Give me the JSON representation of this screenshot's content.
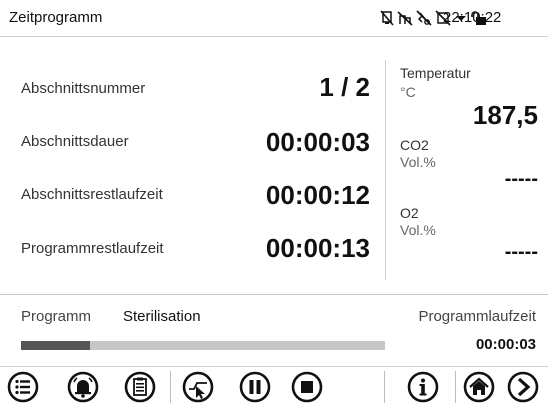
{
  "header": {
    "title": "Zeitprogramm",
    "clock": "22:10:22",
    "status_icons": [
      "no-alarm-icon",
      "no-network-icon",
      "no-usb-icon",
      "no-card-icon",
      "dropdown-arrow-icon",
      "lock-icon"
    ]
  },
  "segment": {
    "number_label": "Abschnittsnummer",
    "number_value": "1 / 2",
    "duration_label": "Abschnittsdauer",
    "duration_value": "00:00:03",
    "remaining_label": "Abschnittsrestlaufzeit",
    "remaining_value": "00:00:12",
    "program_remaining_label": "Programmrestlaufzeit",
    "program_remaining_value": "00:00:13"
  },
  "readouts": {
    "temperature_label": "Temperatur",
    "temperature_unit": "°C",
    "temperature_value": "187,5",
    "co2_label": "CO2",
    "co2_unit": "Vol.%",
    "co2_value": "-----",
    "o2_label": "O2",
    "o2_unit": "Vol.%",
    "o2_value": "-----"
  },
  "program": {
    "label": "Programm",
    "name": "Sterilisation",
    "runtime_label": "Programmlaufzeit",
    "runtime_value": "00:00:03",
    "progress_fraction": 0.19
  },
  "toolbar": {
    "buttons": [
      "menu-icon",
      "alarm-bell-icon",
      "clipboard-icon",
      "program-start-icon",
      "pause-icon",
      "stop-icon",
      "info-icon",
      "home-icon",
      "next-icon"
    ]
  },
  "colors": {
    "icon_stroke": "#111111",
    "progress_fill": "#555555",
    "progress_track": "#c6c6c6"
  }
}
